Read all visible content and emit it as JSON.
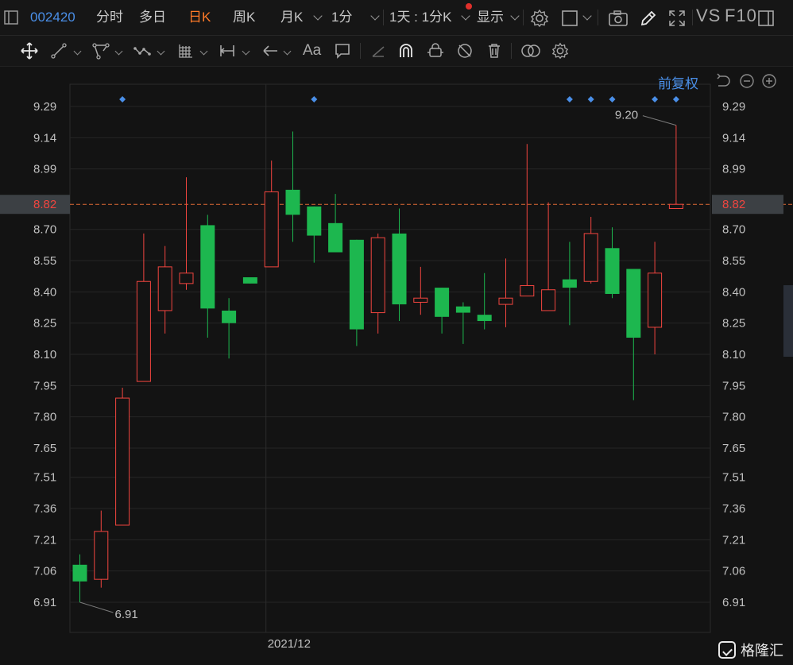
{
  "topbar": {
    "code": "002420",
    "tabs": [
      "分时",
      "多日",
      "日K",
      "周K",
      "月K",
      "1分"
    ],
    "active_tab": "日K",
    "period": "1天 : 1分K",
    "display": "显示",
    "vs": "VS",
    "f10": "F10"
  },
  "toolbar": {
    "font_label": "Aa"
  },
  "controls": {
    "adjust": "前复权"
  },
  "brand": {
    "name": "格隆汇"
  },
  "colors": {
    "up": "#f2453f",
    "down": "#1db74f",
    "price_line": "#e06a35",
    "accent": "#4a8fe8",
    "active_tab": "#ff7a28"
  },
  "chart_data": {
    "type": "candlestick",
    "x_label": "2021/12",
    "y_ticks": [
      "9.29",
      "9.14",
      "8.99",
      "8.70",
      "8.55",
      "8.40",
      "8.25",
      "8.10",
      "7.95",
      "7.80",
      "7.65",
      "7.51",
      "7.36",
      "7.21",
      "7.06",
      "6.91"
    ],
    "y_tick_values": [
      9.29,
      9.14,
      8.99,
      8.7,
      8.55,
      8.4,
      8.25,
      8.1,
      7.95,
      7.8,
      7.65,
      7.51,
      7.36,
      7.21,
      7.06,
      6.91
    ],
    "ylim": [
      6.91,
      9.29
    ],
    "current_price": 8.82,
    "current_price_label": "8.82",
    "max_label": "9.20",
    "min_label": "6.91",
    "candles": [
      {
        "o": 7.09,
        "h": 7.14,
        "l": 6.91,
        "c": 7.01
      },
      {
        "o": 7.02,
        "h": 7.35,
        "l": 6.98,
        "c": 7.25
      },
      {
        "o": 7.28,
        "h": 7.94,
        "l": 7.28,
        "c": 7.89
      },
      {
        "o": 7.97,
        "h": 8.68,
        "l": 7.97,
        "c": 8.45
      },
      {
        "o": 8.31,
        "h": 8.62,
        "l": 8.2,
        "c": 8.52
      },
      {
        "o": 8.44,
        "h": 8.95,
        "l": 8.41,
        "c": 8.49
      },
      {
        "o": 8.72,
        "h": 8.77,
        "l": 8.18,
        "c": 8.32
      },
      {
        "o": 8.31,
        "h": 8.37,
        "l": 8.08,
        "c": 8.25
      },
      {
        "o": 8.47,
        "h": 8.47,
        "l": 8.44,
        "c": 8.44
      },
      {
        "o": 8.52,
        "h": 9.03,
        "l": 8.52,
        "c": 8.88
      },
      {
        "o": 8.89,
        "h": 9.17,
        "l": 8.64,
        "c": 8.77
      },
      {
        "o": 8.81,
        "h": 8.81,
        "l": 8.54,
        "c": 8.67
      },
      {
        "o": 8.73,
        "h": 8.87,
        "l": 8.6,
        "c": 8.59
      },
      {
        "o": 8.65,
        "h": 8.65,
        "l": 8.14,
        "c": 8.22
      },
      {
        "o": 8.3,
        "h": 8.68,
        "l": 8.2,
        "c": 8.66
      },
      {
        "o": 8.68,
        "h": 8.8,
        "l": 8.26,
        "c": 8.34
      },
      {
        "o": 8.35,
        "h": 8.52,
        "l": 8.29,
        "c": 8.37
      },
      {
        "o": 8.42,
        "h": 8.42,
        "l": 8.2,
        "c": 8.28
      },
      {
        "o": 8.33,
        "h": 8.35,
        "l": 8.15,
        "c": 8.3
      },
      {
        "o": 8.29,
        "h": 8.49,
        "l": 8.22,
        "c": 8.26
      },
      {
        "o": 8.34,
        "h": 8.56,
        "l": 8.23,
        "c": 8.37
      },
      {
        "o": 8.38,
        "h": 9.11,
        "l": 8.38,
        "c": 8.43
      },
      {
        "o": 8.31,
        "h": 8.83,
        "l": 8.31,
        "c": 8.41
      },
      {
        "o": 8.46,
        "h": 8.64,
        "l": 8.24,
        "c": 8.42
      },
      {
        "o": 8.45,
        "h": 8.76,
        "l": 8.44,
        "c": 8.68
      },
      {
        "o": 8.61,
        "h": 8.71,
        "l": 8.37,
        "c": 8.39
      },
      {
        "o": 8.51,
        "h": 8.51,
        "l": 7.88,
        "c": 8.18
      },
      {
        "o": 8.23,
        "h": 8.64,
        "l": 8.1,
        "c": 8.49
      },
      {
        "o": 8.8,
        "h": 9.2,
        "l": 8.8,
        "c": 8.82
      }
    ],
    "event_marker_candles": [
      2,
      11,
      23,
      24,
      25,
      27,
      28
    ],
    "x_label_candle": 9
  }
}
